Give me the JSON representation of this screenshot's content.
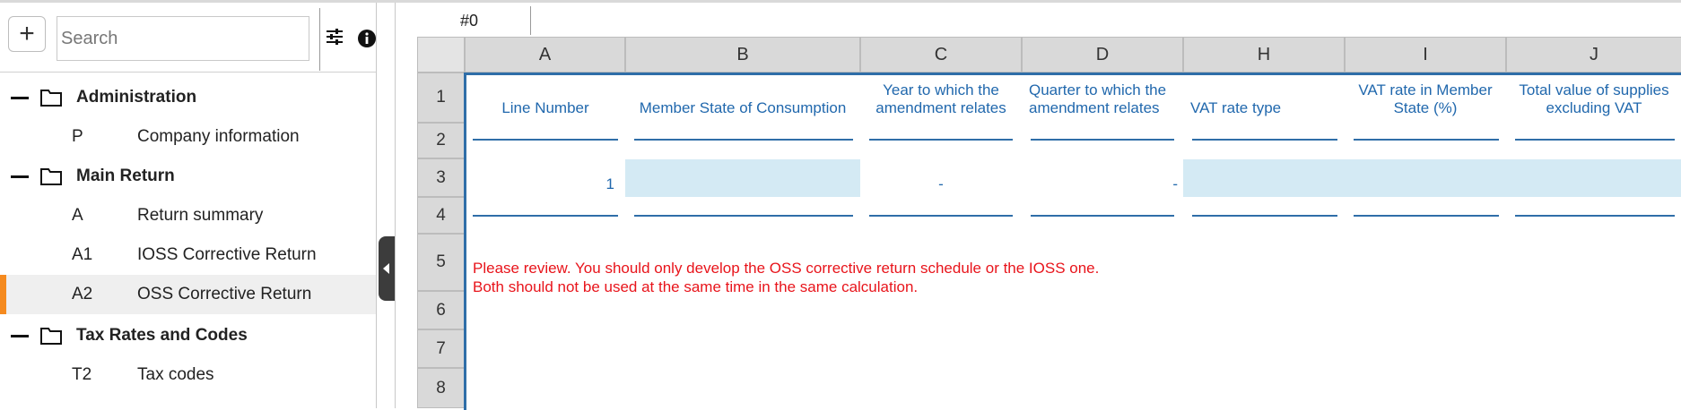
{
  "sidebar": {
    "search_placeholder": "Search",
    "add_label": "+",
    "groups": [
      {
        "label": "Administration",
        "items": [
          {
            "code": "P",
            "label": "Company information"
          }
        ]
      },
      {
        "label": "Main Return",
        "items": [
          {
            "code": "A",
            "label": "Return summary"
          },
          {
            "code": "A1",
            "label": "IOSS Corrective Return"
          },
          {
            "code": "A2",
            "label": "OSS Corrective Return",
            "active": true
          }
        ]
      },
      {
        "label": "Tax Rates and Codes",
        "items": [
          {
            "code": "T2",
            "label": "Tax codes"
          }
        ]
      }
    ]
  },
  "sheet": {
    "cell_ref": "#0",
    "columns": [
      "A",
      "B",
      "C",
      "D",
      "H",
      "I",
      "J"
    ],
    "rows": [
      "1",
      "2",
      "3",
      "4",
      "5",
      "6",
      "7",
      "8"
    ],
    "headers": {
      "A": "Line Number",
      "B": "Member State of Consumption",
      "C": "Year to which the amendment relates",
      "D": "Quarter to which the amendment relates",
      "H": "VAT rate type",
      "I": "VAT rate in Member State (%)",
      "J": "Total value of supplies excluding VAT"
    },
    "row3": {
      "A": "1",
      "C": "-",
      "D": "-"
    },
    "warning_line1": "Please review. You should only develop the OSS corrective return schedule or the IOSS one.",
    "warning_line2": "Both should not be used at the same time in the same calculation."
  },
  "colors": {
    "accent": "#f58a1f",
    "link_blue": "#2168ad",
    "input_fill": "#d4eaf4",
    "warning_red": "#e8141b"
  }
}
